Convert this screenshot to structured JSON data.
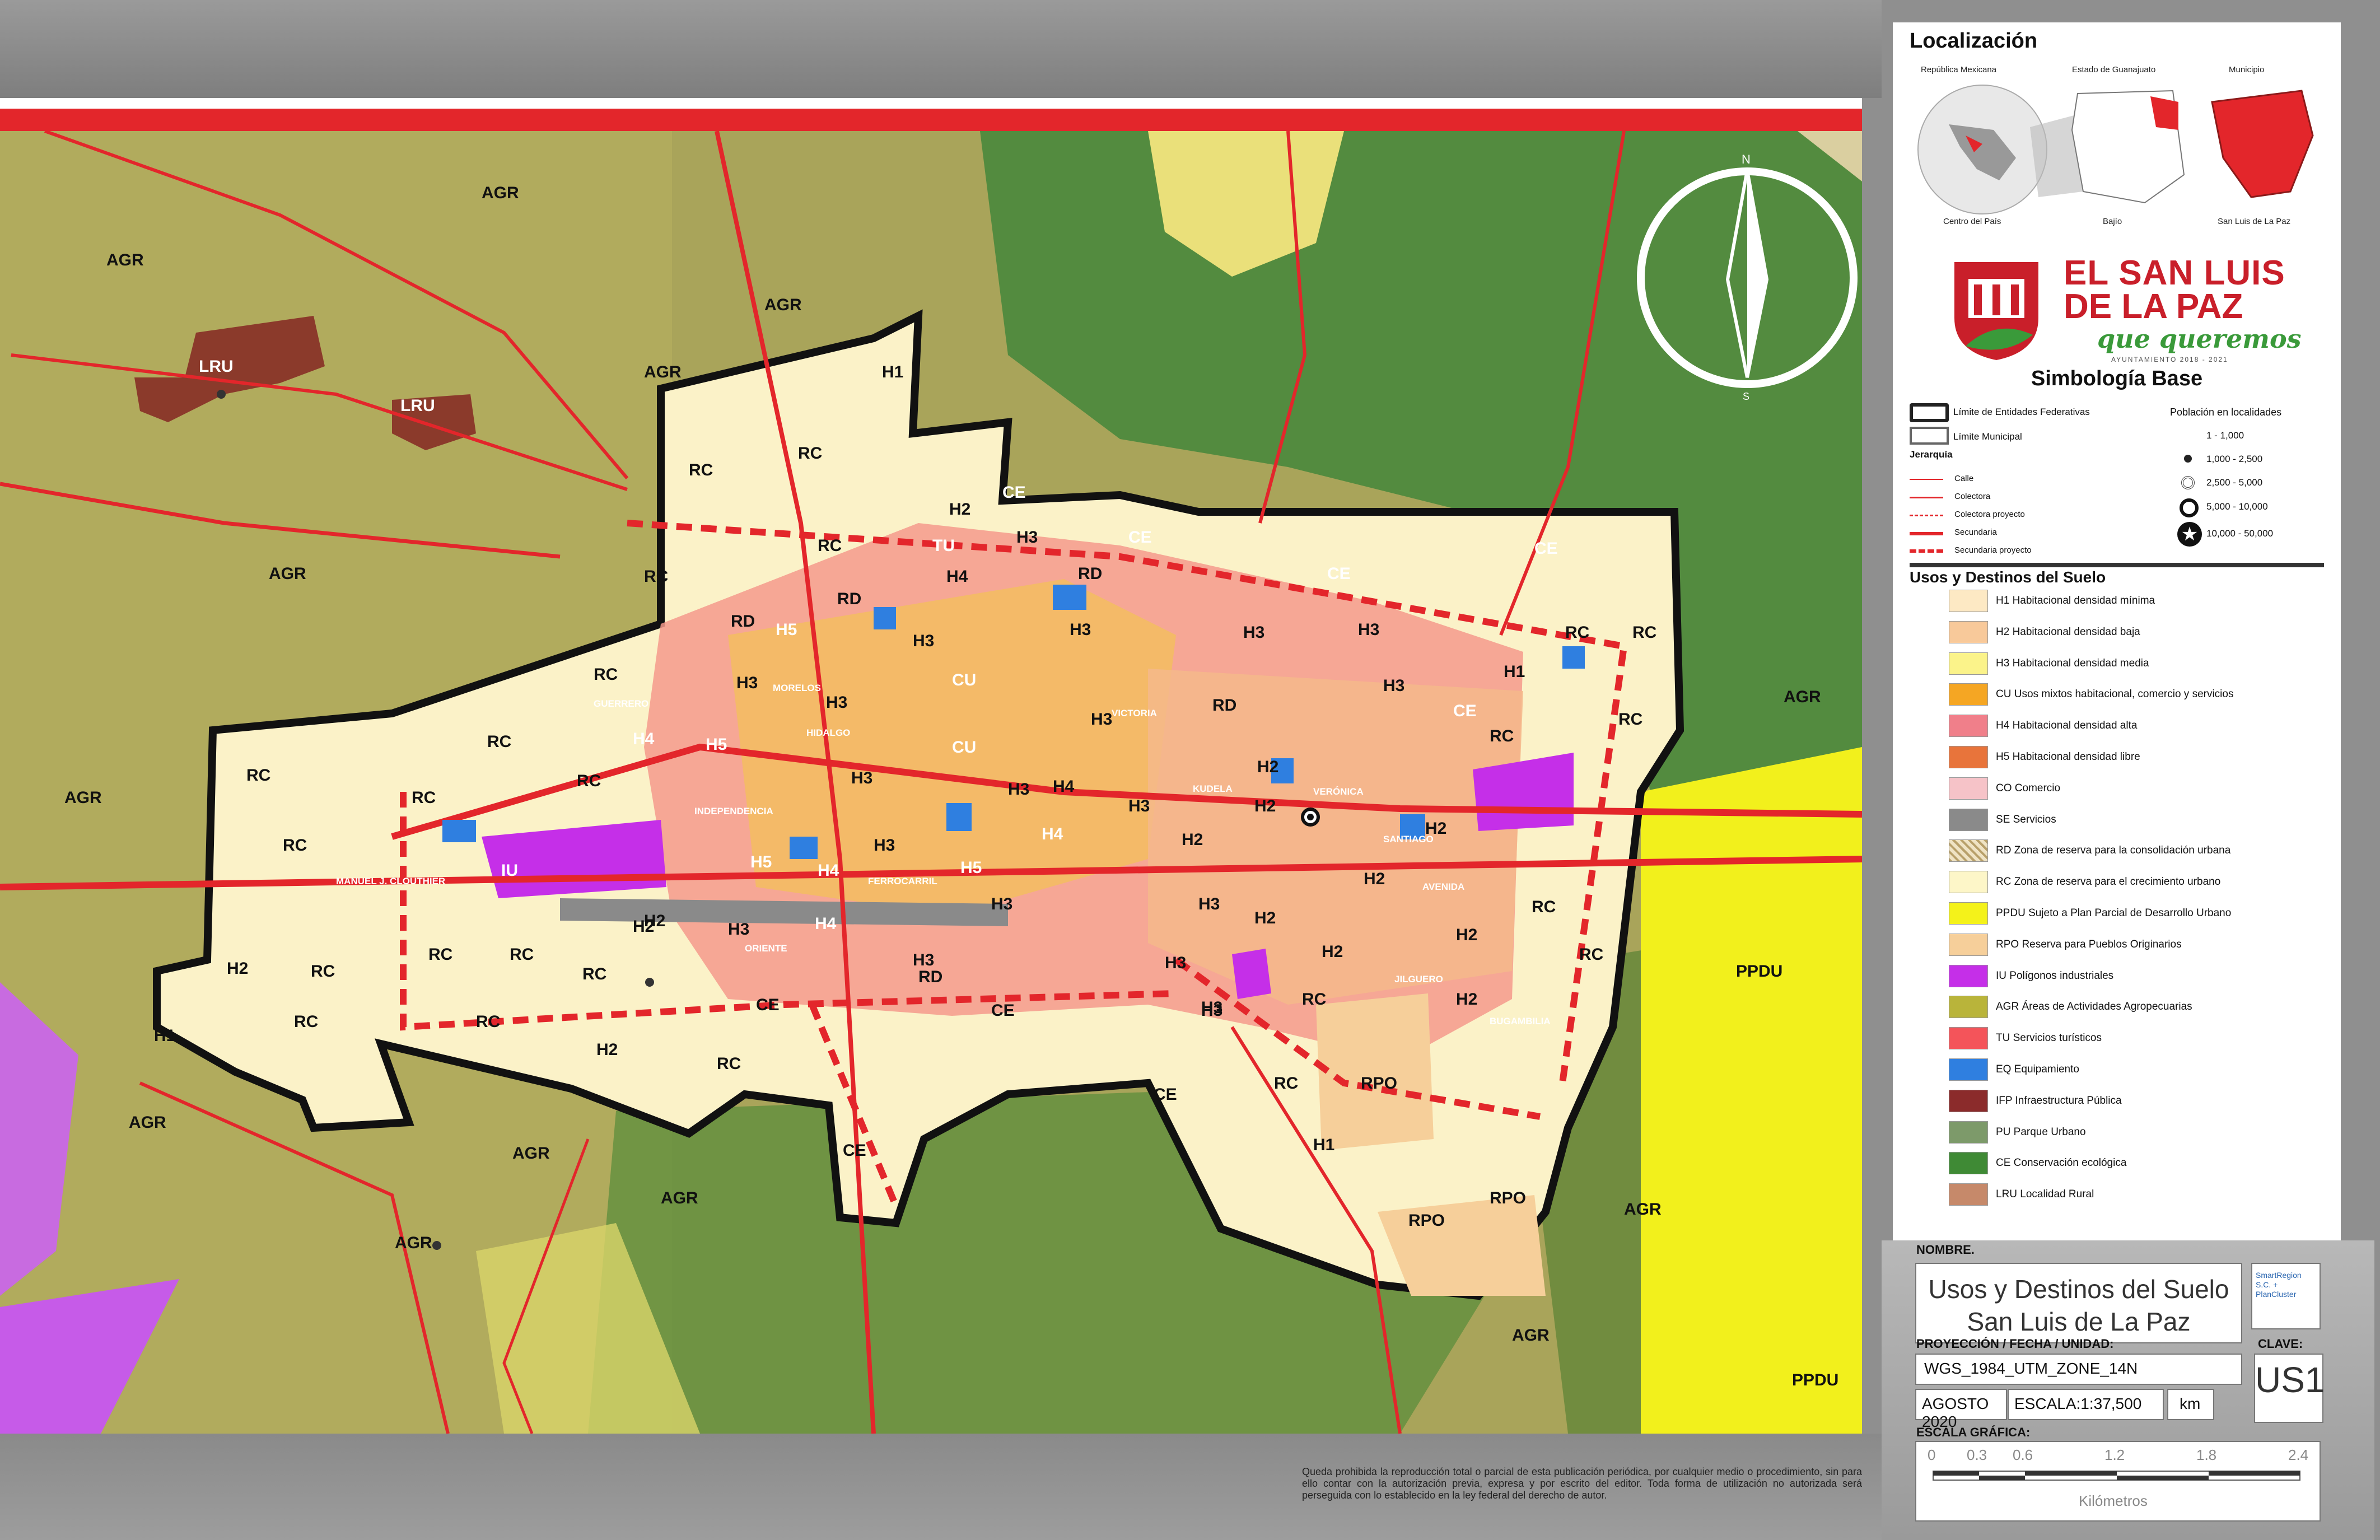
{
  "map": {
    "zone_labels": [
      "AGR",
      "AGR",
      "AGR",
      "AGR",
      "AGR",
      "AGR",
      "AGR",
      "AGR",
      "AGR",
      "AGR",
      "AGR",
      "AGR",
      "AGR",
      "LRU",
      "LRU",
      "H1",
      "RC",
      "RC",
      "RC",
      "RC",
      "RC",
      "RC",
      "RC",
      "RC",
      "RC",
      "RC",
      "RC",
      "RC",
      "RC",
      "RC",
      "RC",
      "RC",
      "RC",
      "RC",
      "RC",
      "RC",
      "RC",
      "RC",
      "RC",
      "RC",
      "RC",
      "RD",
      "RD",
      "RD",
      "RD",
      "RD",
      "CE",
      "CE",
      "CE",
      "CE",
      "CE",
      "CE",
      "CE",
      "CE",
      "CE",
      "TU",
      "H2",
      "H3",
      "H4",
      "H3",
      "H5",
      "H3",
      "H3",
      "H3",
      "H3",
      "H3",
      "H3",
      "H3",
      "CU",
      "CU",
      "H4",
      "H5",
      "H3",
      "H3",
      "H4",
      "H3",
      "H5",
      "H5",
      "H3",
      "H4",
      "H4",
      "H2",
      "H3",
      "H4",
      "H3",
      "H2",
      "H3",
      "H2",
      "H3",
      "H3",
      "H2",
      "H2",
      "H2",
      "H2",
      "H2",
      "H2",
      "H2",
      "H2",
      "H2",
      "H2",
      "H1",
      "H1",
      "H1",
      "H3",
      "H3",
      "IU",
      "PPDU",
      "PPDU",
      "RPO",
      "RPO",
      "RPO"
    ],
    "street_labels": [
      "GUERRERO",
      "MANUEL J. CLOUTHIER",
      "FERROCARRIL",
      "HIDALGO",
      "VICTORIA",
      "SANTIAGO",
      "MORELOS",
      "JILGUERO",
      "BUGAMBILIA",
      "KUDELA",
      "AVENIDA",
      "VERÓNICA",
      "ORIENTE",
      "INDEPENDENCIA"
    ],
    "copyright": "Queda prohibida la reproducción total o parcial de esta publicación periódica, por cualquier medio o procedimiento, sin para ello contar con la autorización previa, expresa y por escrito del editor. Toda forma de utilización no autorizada será perseguida con lo establecido en la ley federal del derecho de autor."
  },
  "north_arrow": {
    "n": "N",
    "s": "S"
  },
  "localizacion": {
    "title": "Localización",
    "captions_top": [
      "República Mexicana",
      "Estado de Guanajuato",
      "Municipio"
    ],
    "captions_bottom": [
      "Centro del País",
      "Bajío",
      "San Luis de La Paz"
    ]
  },
  "logo": {
    "line1": "EL SAN LUIS",
    "line2": "DE LA PAZ",
    "line3": "que queremos",
    "line4": "AYUNTAMIENTO 2018 - 2021"
  },
  "simbologia": {
    "title": "Simbología Base",
    "limits": [
      "Límite de Entidades Federativas",
      "Límite Municipal"
    ],
    "jerarquia_title": "Jerarquía",
    "jerarquia": [
      "Calle",
      "Colectora",
      "Colectora proyecto",
      "Secundaria",
      "Secundaria proyecto"
    ],
    "poblacion_title": "Población en localidades",
    "poblacion": [
      "1 - 1,000",
      "1,000 - 2,500",
      "2,500 - 5,000",
      "5,000 - 10,000",
      "10,000 - 50,000"
    ]
  },
  "usos": {
    "title": "Usos y Destinos del Suelo",
    "items": [
      {
        "label": "H1 Habitacional densidad mínima",
        "color": "#fde9c4"
      },
      {
        "label": "H2 Habitacional densidad baja",
        "color": "#f8c99a"
      },
      {
        "label": "H3 Habitacional densidad media",
        "color": "#fbf38a"
      },
      {
        "label": "CU Usos mixtos habitacional, comercio y servicios",
        "color": "#f5a623"
      },
      {
        "label": "H4 Habitacional densidad alta",
        "color": "#f07f8a"
      },
      {
        "label": "H5 Habitacional densidad libre",
        "color": "#e8743b"
      },
      {
        "label": "CO Comercio",
        "color": "#f6c3c8"
      },
      {
        "label": "SE Servicios",
        "color": "#8a8a8a"
      },
      {
        "label": "RD Zona de reserva para la consolidación urbana",
        "color": "#e9d8b0"
      },
      {
        "label": "RC Zona de reserva para el crecimiento urbano",
        "color": "#fdf6c8"
      },
      {
        "label": "PPDU Sujeto a Plan Parcial de Desarrollo Urbano",
        "color": "#f4f21a"
      },
      {
        "label": "RPO Reserva para Pueblos Originarios",
        "color": "#f6cf9a"
      },
      {
        "label": "IU Polígonos industriales",
        "color": "#c52fe8"
      },
      {
        "label": "AGR Áreas de Actividades Agropecuarias",
        "color": "#b9b43a"
      },
      {
        "label": "TU Servicios turísticos",
        "color": "#f4545a"
      },
      {
        "label": "EQ Equipamiento",
        "color": "#2f7fe0"
      },
      {
        "label": "IFP Infraestructura Pública",
        "color": "#8b2b2b"
      },
      {
        "label": "PU Parque Urbano",
        "color": "#7d9a6a"
      },
      {
        "label": "CE Conservación ecológica",
        "color": "#3f8a35"
      },
      {
        "label": "LRU Localidad Rural",
        "color": "#c6896a"
      }
    ]
  },
  "info": {
    "nombre_label": "NOMBRE.",
    "nombre_line1": "Usos y Destinos del Suelo",
    "nombre_line2": "San Luis de La Paz",
    "proyeccion_label": "PROYECCIÓN / FECHA / UNIDAD:",
    "proyeccion": "WGS_1984_UTM_ZONE_14N",
    "fecha": "AGOSTO 2020",
    "escala": "ESCALA:1:37,500",
    "unidad": "km",
    "clave_label": "CLAVE:",
    "clave": "US1",
    "escala_grafica_label": "ESCALA GRÁFICA:",
    "scale_ticks": [
      "0",
      "0.3",
      "0.6",
      "1.2",
      "1.8",
      "2.4"
    ],
    "scale_unit": "Kilómetros",
    "partner": "SmartRegion S.C. + PlanCluster"
  }
}
